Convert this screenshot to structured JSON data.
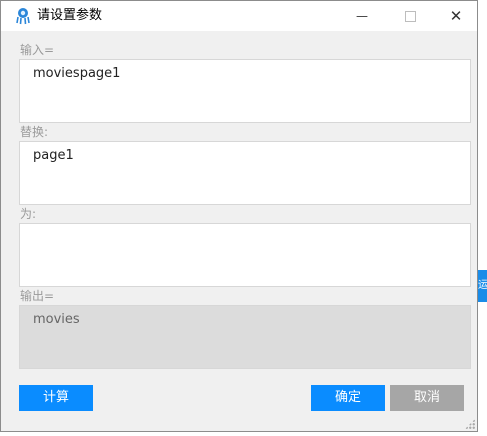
{
  "window": {
    "title": "请设置参数"
  },
  "controls": {
    "minimize": "—",
    "close": "✕"
  },
  "fields": [
    {
      "label": "输入=",
      "value": "moviespage1"
    },
    {
      "label": "替换:",
      "value": "page1"
    },
    {
      "label": "为:",
      "value": ""
    },
    {
      "label": "输出=",
      "value": "movies"
    }
  ],
  "buttons": {
    "compute": "计算",
    "confirm": "确定",
    "cancel": "取消"
  },
  "colors": {
    "primary": "#0a8cff",
    "disabled": "#a6a6a6",
    "output_bg": "#dcdcdc"
  },
  "background": {
    "partial_text": "运"
  }
}
